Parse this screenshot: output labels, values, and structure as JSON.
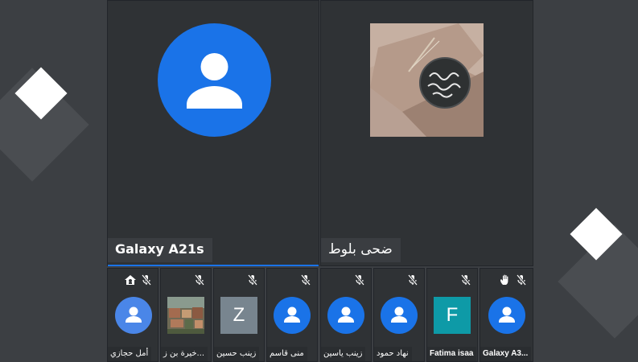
{
  "main_participants": [
    {
      "name": "Galaxy A21s"
    },
    {
      "name": "ضحى بلوط"
    }
  ],
  "strip_participants": [
    {
      "name": "أمل حجازي",
      "avatar": "default-person",
      "icons": [
        "home-icon",
        "mic-off-icon"
      ]
    },
    {
      "name": "خيرة بن ز...",
      "avatar": "photo",
      "icons": [
        "mic-off-icon"
      ]
    },
    {
      "name": "زينب حسين",
      "avatar": "letter",
      "letter": "Z",
      "color": "#78858f",
      "icons": [
        "mic-off-icon"
      ]
    },
    {
      "name": "منى قاسم",
      "avatar": "default-person",
      "icons": [
        "mic-off-icon"
      ]
    },
    {
      "name": "زينب ياسين",
      "avatar": "default-person",
      "icons": [
        "mic-off-icon"
      ]
    },
    {
      "name": "نهاد حمود",
      "avatar": "default-person",
      "icons": [
        "mic-off-icon"
      ]
    },
    {
      "name": "Fatima isaa",
      "avatar": "letter",
      "letter": "F",
      "color": "#0e9aa7",
      "icons": [
        "mic-off-icon"
      ]
    },
    {
      "name": "Galaxy A3...",
      "avatar": "default-person",
      "icons": [
        "raised-hand-icon",
        "mic-off-icon"
      ]
    }
  ],
  "colors": {
    "accent": "#1a73e8",
    "background": "#3c3f43",
    "tile": "#2f3235"
  }
}
